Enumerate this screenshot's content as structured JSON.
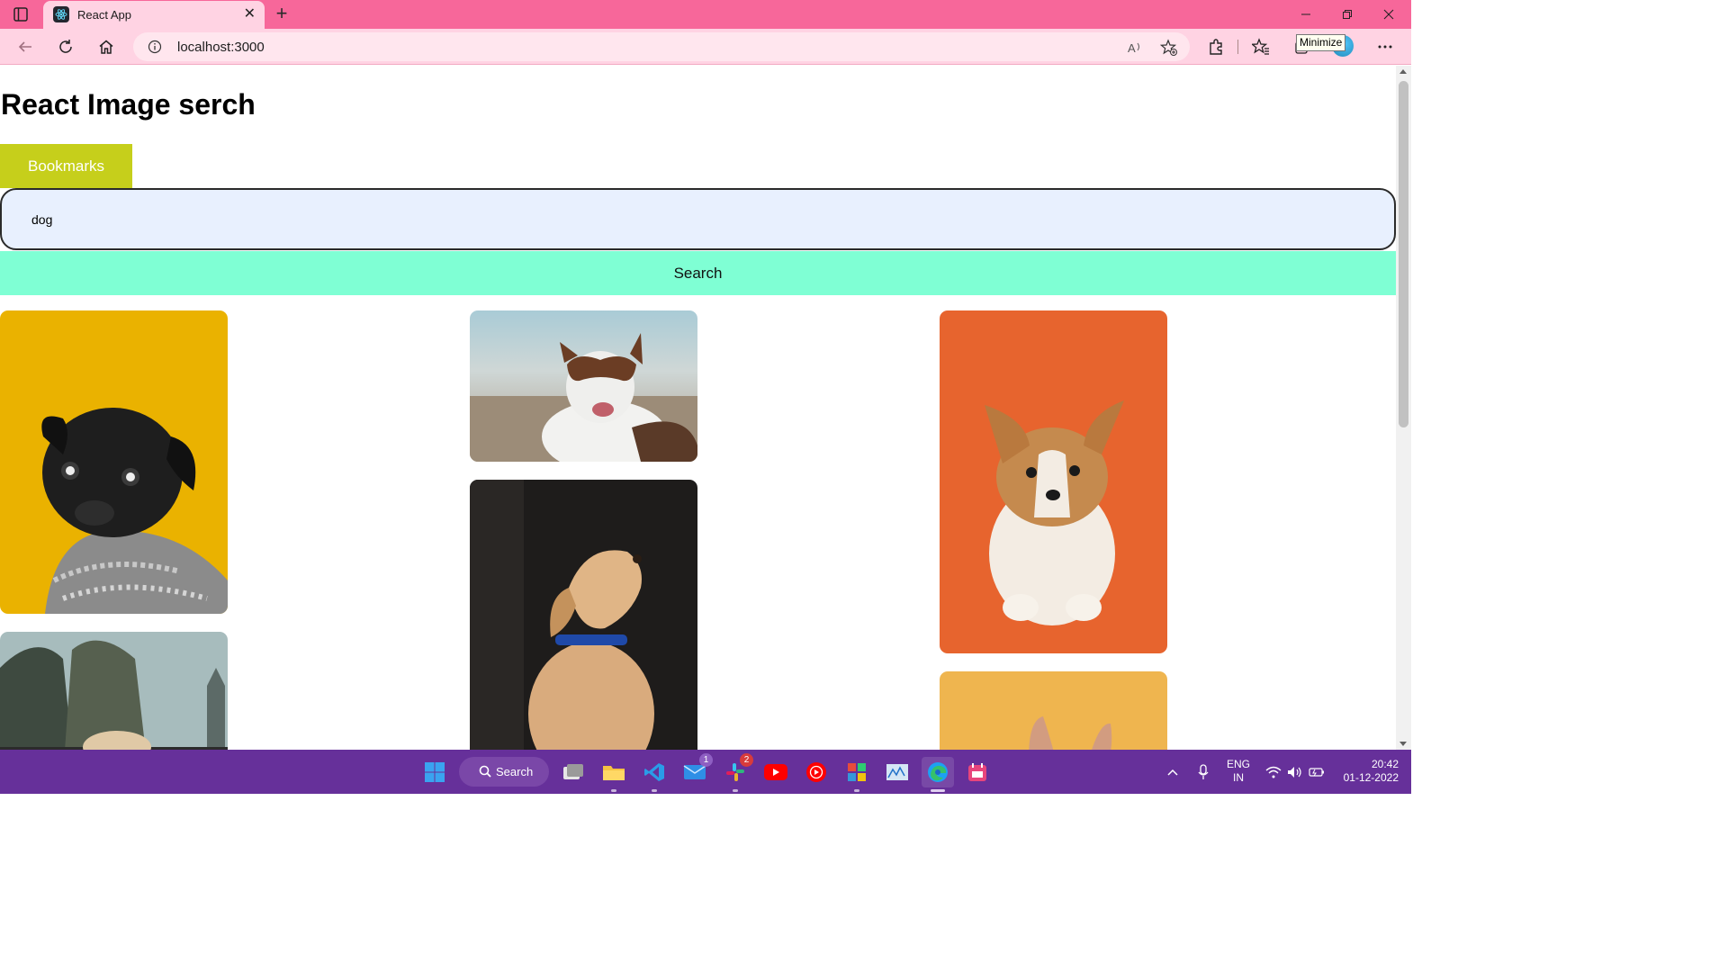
{
  "browser": {
    "tab_title": "React App",
    "url": "localhost:3000",
    "tooltip": "Minimize"
  },
  "page": {
    "title": "React Image serch",
    "bookmarks_label": "Bookmarks",
    "search_value": "dog",
    "search_button_label": "Search"
  },
  "images": [
    {
      "subject": "black pug in knit sweater on yellow background"
    },
    {
      "subject": "white and brown dog on beach"
    },
    {
      "subject": "corgi puppy on orange background"
    },
    {
      "subject": "dog paws on car window with trees"
    },
    {
      "subject": "labrador puppy with blue collar"
    },
    {
      "subject": "dog ears on yellow background"
    }
  ],
  "taskbar": {
    "search_label": "Search",
    "mail_badge": "1",
    "slack_badge": "2",
    "lang_line1": "ENG",
    "lang_line2": "IN",
    "time": "20:42",
    "date": "01-12-2022"
  },
  "colors": {
    "titlebar": "#f7679a",
    "toolbar": "#ffd3e3",
    "bookmarks_button": "#c6cf1b",
    "search_button": "#7fffd4",
    "search_input": "#e8f0fe",
    "taskbar": "#66309a"
  }
}
